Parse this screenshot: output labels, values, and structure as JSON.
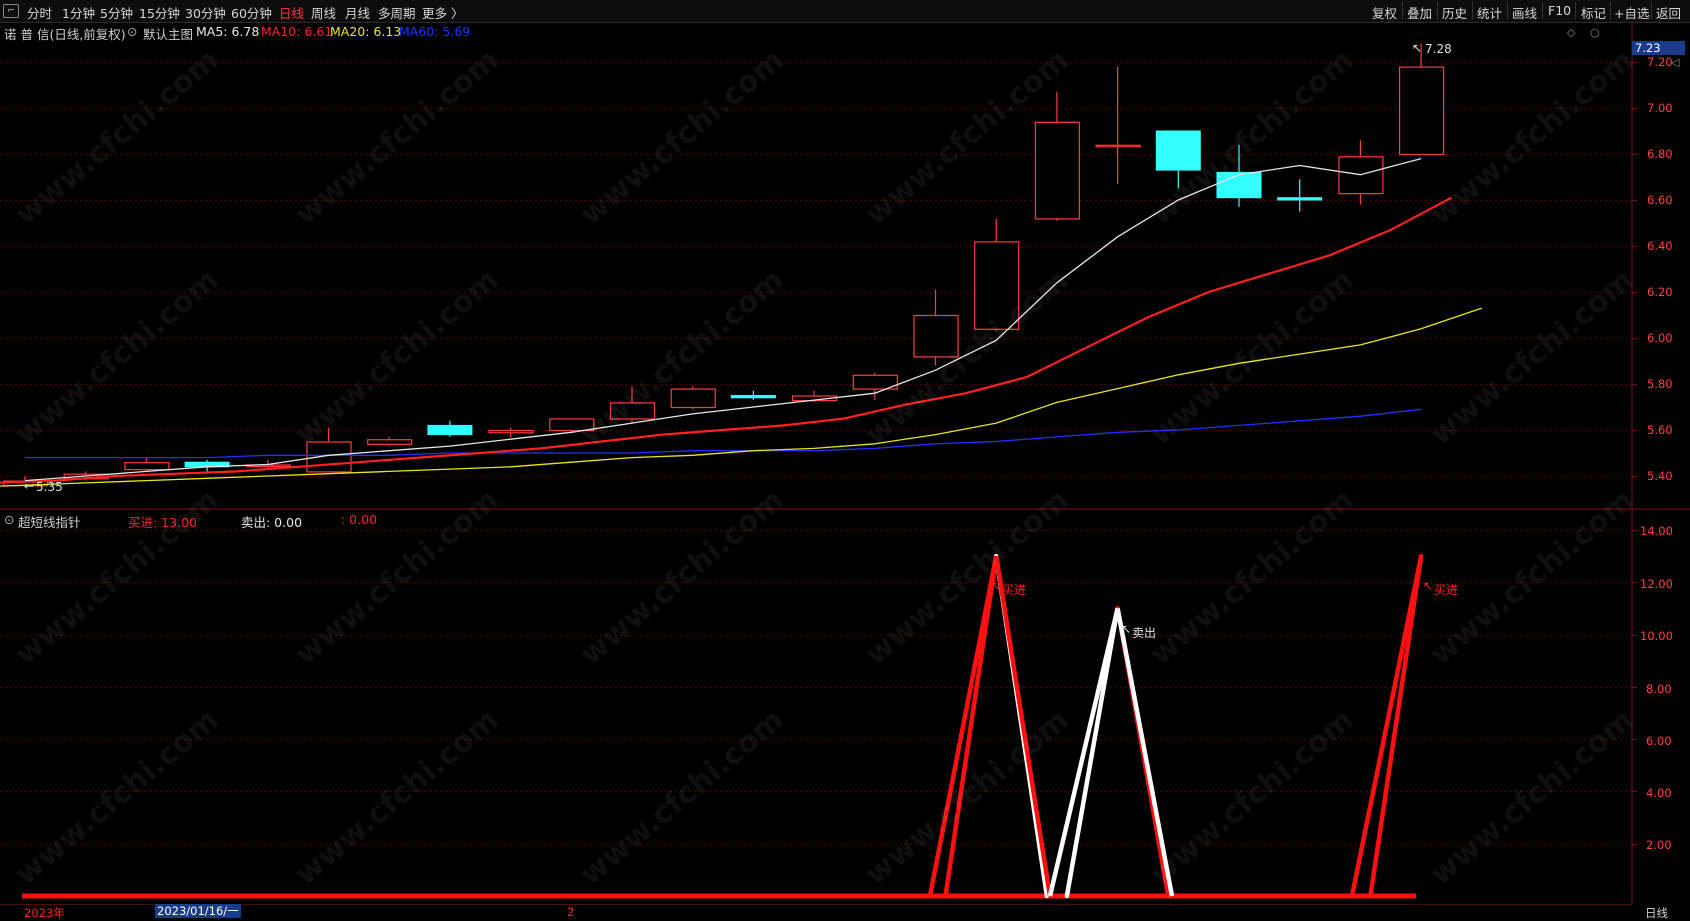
{
  "toolbar": {
    "tabs": [
      "分时",
      "1分钟",
      "5分钟",
      "15分钟",
      "30分钟",
      "60分钟",
      "日线",
      "周线",
      "月线",
      "多周期",
      "更多 〉"
    ],
    "active_tab": "日线",
    "right_tools": [
      "复权",
      "叠加",
      "历史",
      "统计",
      "画线",
      "F10",
      "标记",
      "+自选",
      "返回"
    ]
  },
  "main_panel": {
    "stock_name": "诺 普 信(日线,前复权)",
    "indicator_toggle": "默认主图",
    "ma5_label": "MA5: 6.78",
    "ma10_label": "MA10: 6.61",
    "ma20_label": "MA20: 6.13",
    "ma60_label": "MA60: 5.69",
    "current_price_badge": "7.23",
    "high_marker": "7.28",
    "low_marker": "5.35",
    "y_ticks": [
      "7.20",
      "7.00",
      "6.80",
      "6.60",
      "6.40",
      "6.20",
      "6.00",
      "5.80",
      "5.60",
      "5.40"
    ]
  },
  "indicator_panel": {
    "name": "超短线指针",
    "buy_label": "买进: 13.00",
    "sell_label": "卖出: 0.00",
    "extra_label": ": 0.00",
    "y_ticks": [
      "14.00",
      "12.00",
      "10.00",
      "8.00",
      "6.00",
      "4.00",
      "2.00"
    ],
    "annotations": [
      "买进",
      "卖出",
      "买进"
    ]
  },
  "bottom_bar": {
    "year_label": "2023年",
    "date_label": "2023/01/16/一",
    "mid_label": "2",
    "period_label": "日线"
  },
  "watermark_text": "www.cfchi.com",
  "colors": {
    "up": "#ff3b3b",
    "down": "#33ffff",
    "ma5": "#e6e6e6",
    "ma10": "#ff2020",
    "ma20": "#e6e61e",
    "ma60": "#2030ff",
    "grid": "#5a0000"
  },
  "chart_data": {
    "type": "candlestick",
    "candles": [
      {
        "open": 5.36,
        "close": 5.38,
        "high": 5.4,
        "low": 5.35
      },
      {
        "open": 5.39,
        "close": 5.41,
        "high": 5.42,
        "low": 5.38
      },
      {
        "open": 5.43,
        "close": 5.46,
        "high": 5.48,
        "low": 5.42
      },
      {
        "open": 5.46,
        "close": 5.44,
        "high": 5.47,
        "low": 5.42
      },
      {
        "open": 5.45,
        "close": 5.45,
        "high": 5.47,
        "low": 5.43
      },
      {
        "open": 5.42,
        "close": 5.55,
        "high": 5.61,
        "low": 5.42
      },
      {
        "open": 5.54,
        "close": 5.56,
        "high": 5.57,
        "low": 5.53
      },
      {
        "open": 5.62,
        "close": 5.58,
        "high": 5.64,
        "low": 5.57
      },
      {
        "open": 5.59,
        "close": 5.6,
        "high": 5.61,
        "low": 5.57
      },
      {
        "open": 5.6,
        "close": 5.65,
        "high": 5.65,
        "low": 5.59
      },
      {
        "open": 5.65,
        "close": 5.72,
        "high": 5.79,
        "low": 5.63
      },
      {
        "open": 5.7,
        "close": 5.78,
        "high": 5.79,
        "low": 5.69
      },
      {
        "open": 5.75,
        "close": 5.74,
        "high": 5.77,
        "low": 5.73
      },
      {
        "open": 5.73,
        "close": 5.75,
        "high": 5.77,
        "low": 5.72
      },
      {
        "open": 5.78,
        "close": 5.84,
        "high": 5.85,
        "low": 5.73
      },
      {
        "open": 5.92,
        "close": 6.1,
        "high": 6.21,
        "low": 5.88
      },
      {
        "open": 6.04,
        "close": 6.42,
        "high": 6.52,
        "low": 6.03
      },
      {
        "open": 6.52,
        "close": 6.94,
        "high": 7.07,
        "low": 6.51
      },
      {
        "open": 6.84,
        "close": 6.84,
        "high": 7.18,
        "low": 6.67
      },
      {
        "open": 6.9,
        "close": 6.73,
        "high": 6.9,
        "low": 6.65
      },
      {
        "open": 6.72,
        "close": 6.61,
        "high": 6.84,
        "low": 6.57
      },
      {
        "open": 6.61,
        "close": 6.6,
        "high": 6.69,
        "low": 6.55
      },
      {
        "open": 6.63,
        "close": 6.79,
        "high": 6.86,
        "low": 6.58
      },
      {
        "open": 6.8,
        "close": 7.18,
        "high": 7.28,
        "low": 6.8
      }
    ],
    "ma5": [
      5.38,
      5.4,
      5.42,
      5.44,
      5.45,
      5.49,
      5.51,
      5.53,
      5.56,
      5.59,
      5.63,
      5.67,
      5.7,
      5.73,
      5.76,
      5.86,
      5.99,
      6.24,
      6.44,
      6.6,
      6.71,
      6.75,
      6.71,
      6.78
    ],
    "ma10": [
      5.37,
      5.38,
      5.4,
      5.41,
      5.42,
      5.44,
      5.46,
      5.48,
      5.5,
      5.52,
      5.55,
      5.58,
      5.6,
      5.62,
      5.65,
      5.71,
      5.76,
      5.83,
      5.96,
      6.09,
      6.2,
      6.28,
      6.36,
      6.47,
      6.61
    ],
    "ma20": [
      5.35,
      5.36,
      5.37,
      5.38,
      5.39,
      5.4,
      5.41,
      5.42,
      5.43,
      5.44,
      5.46,
      5.48,
      5.49,
      5.51,
      5.52,
      5.54,
      5.58,
      5.63,
      5.72,
      5.78,
      5.84,
      5.89,
      5.93,
      5.97,
      6.04,
      6.13
    ],
    "ma60": [
      5.48,
      5.48,
      5.48,
      5.48,
      5.49,
      5.49,
      5.49,
      5.5,
      5.5,
      5.5,
      5.5,
      5.51,
      5.51,
      5.51,
      5.52,
      5.54,
      5.55,
      5.57,
      5.59,
      5.6,
      5.62,
      5.64,
      5.66,
      5.69
    ],
    "indicator": [
      0,
      0,
      0,
      0,
      0,
      0,
      0,
      0,
      0,
      0,
      0,
      0,
      0,
      0,
      0,
      0,
      13,
      0,
      11,
      0,
      0,
      0,
      0,
      13
    ],
    "indicator_colors": [
      "r",
      "r",
      "r",
      "r",
      "r",
      "r",
      "r",
      "r",
      "r",
      "r",
      "r",
      "r",
      "r",
      "r",
      "r",
      "r",
      "r",
      "w",
      "w",
      "r",
      "r",
      "r",
      "r",
      "r"
    ],
    "price_range": [
      5.3,
      7.28
    ],
    "indicator_range": [
      0,
      14
    ]
  }
}
